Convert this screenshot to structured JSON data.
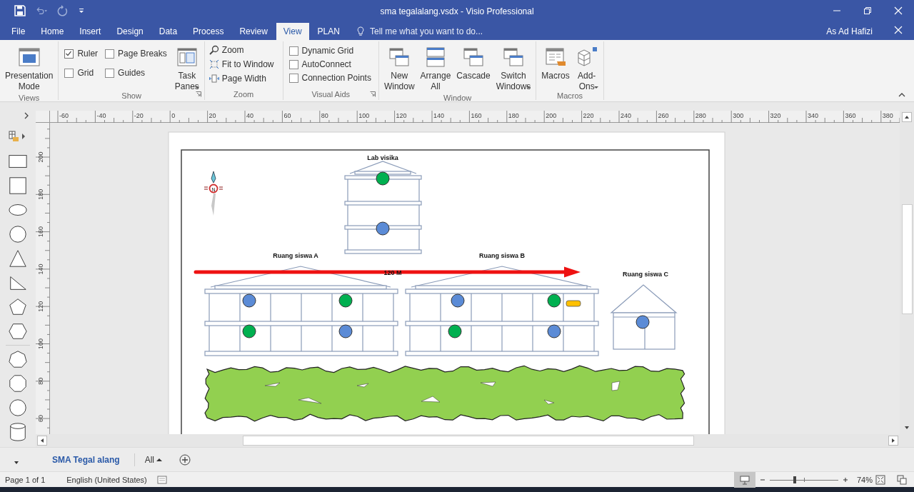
{
  "window": {
    "title": "sma tegalalang.vsdx - Visio Professional",
    "user": "As Ad Hafizi"
  },
  "tabs": [
    {
      "label": "File",
      "selected": false
    },
    {
      "label": "Home",
      "selected": false
    },
    {
      "label": "Insert",
      "selected": false
    },
    {
      "label": "Design",
      "selected": false
    },
    {
      "label": "Data",
      "selected": false
    },
    {
      "label": "Process",
      "selected": false
    },
    {
      "label": "Review",
      "selected": false
    },
    {
      "label": "View",
      "selected": true
    },
    {
      "label": "PLAN",
      "selected": false
    }
  ],
  "tell_me": {
    "placeholder": "Tell me what you want to do..."
  },
  "ribbon": [
    {
      "name": "Views",
      "launcher": false,
      "buttons": [
        {
          "label": "Presentation Mode",
          "dropdown": false
        }
      ]
    },
    {
      "name": "Show",
      "launcher": true,
      "checks": [
        {
          "label": "Ruler",
          "checked": true
        },
        {
          "label": "Page Breaks",
          "checked": false
        },
        {
          "label": "Grid",
          "checked": false
        },
        {
          "label": "Guides",
          "checked": false
        }
      ],
      "buttons": [
        {
          "label": "Task Panes",
          "dropdown": true
        }
      ]
    },
    {
      "name": "Zoom",
      "launcher": false,
      "commands": [
        {
          "label": "Zoom"
        },
        {
          "label": "Fit to Window"
        },
        {
          "label": "Page Width"
        }
      ]
    },
    {
      "name": "Visual Aids",
      "launcher": true,
      "checks": [
        {
          "label": "Dynamic Grid",
          "checked": false
        },
        {
          "label": "AutoConnect",
          "checked": false
        },
        {
          "label": "Connection Points",
          "checked": false
        }
      ]
    },
    {
      "name": "Window",
      "launcher": false,
      "buttons": [
        {
          "label": "New Window",
          "dropdown": false
        },
        {
          "label": "Arrange All",
          "dropdown": false
        },
        {
          "label": "Cascade",
          "dropdown": false
        },
        {
          "label": "Switch Windows",
          "dropdown": true
        }
      ]
    },
    {
      "name": "Macros",
      "launcher": false,
      "buttons": [
        {
          "label": "Macros",
          "dropdown": false
        },
        {
          "label": "Add-Ons",
          "dropdown": true
        }
      ]
    }
  ],
  "rulers": {
    "horizontal": [
      "-60",
      "-40",
      "-20",
      "0",
      "20",
      "40",
      "60",
      "80",
      "100",
      "120",
      "140",
      "160",
      "180",
      "200",
      "220",
      "240",
      "260",
      "280",
      "300",
      "320",
      "340",
      "360",
      "380"
    ],
    "vertical": [
      "200",
      "180",
      "160",
      "140",
      "120",
      "100",
      "80",
      "60"
    ]
  },
  "diagram": {
    "compass": "N",
    "buildings": [
      {
        "name": "Lab visika",
        "kind": "tower",
        "dots": [
          {
            "kind": "circle",
            "color": "#00b050"
          },
          {
            "kind": "circle",
            "color": "#5b8bd6"
          }
        ]
      },
      {
        "name": "Ruang siswa A",
        "kind": "wide",
        "dots": [
          {
            "kind": "circle",
            "color": "#5b8bd6"
          },
          {
            "kind": "circle",
            "color": "#00b050"
          },
          {
            "kind": "circle",
            "color": "#00b050"
          },
          {
            "kind": "circle",
            "color": "#5b8bd6"
          }
        ]
      },
      {
        "name": "Ruang siswa B",
        "kind": "wide",
        "dots": [
          {
            "kind": "circle",
            "color": "#5b8bd6"
          },
          {
            "kind": "circle",
            "color": "#00b050"
          },
          {
            "kind": "circle",
            "color": "#00b050"
          },
          {
            "kind": "circle",
            "color": "#5b8bd6"
          },
          {
            "kind": "bar",
            "color": "#ffc000"
          }
        ]
      },
      {
        "name": "Ruang siswa C",
        "kind": "small",
        "dots": [
          {
            "kind": "circle",
            "color": "#5b8bd6"
          }
        ]
      }
    ],
    "arrow": {
      "label": "120 M"
    }
  },
  "sheets": [
    {
      "label": "SMA Tegal alang",
      "selected": true
    }
  ],
  "sheet_filter": "All",
  "status_bar": {
    "page": "Page 1 of 1",
    "language": "English (United States)",
    "zoom": {
      "level": 0.37
    },
    "zoom_text": "74%"
  }
}
